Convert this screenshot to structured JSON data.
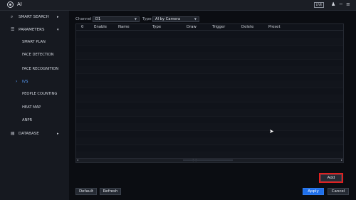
{
  "titlebar": {
    "title": "AI",
    "live_label": "LIVE"
  },
  "sidebar": {
    "smart_search": "SMART SEARCH",
    "parameters": "PARAMETERS",
    "items": [
      "SMART PLAN",
      "FACE DETECTION",
      "FACE RECOGNITION",
      "IVS",
      "PEOPLE COUNTING",
      "HEAT MAP",
      "ANPR"
    ],
    "database": "DATABASE"
  },
  "filters": {
    "channel_label": "Channel",
    "channel_value": "D1",
    "type_label": "Type",
    "type_value": "AI by Camera"
  },
  "table": {
    "columns": [
      "0",
      "Enable",
      "Name",
      "Type",
      "Draw",
      "Trigger",
      "Delete",
      "Preset"
    ]
  },
  "buttons": {
    "add": "Add",
    "default": "Default",
    "refresh": "Refresh",
    "apply": "Apply",
    "cancel": "Cancel"
  },
  "colors": {
    "accent": "#1f6feb",
    "highlight": "#e02020",
    "active_nav": "#5aa0ff"
  }
}
